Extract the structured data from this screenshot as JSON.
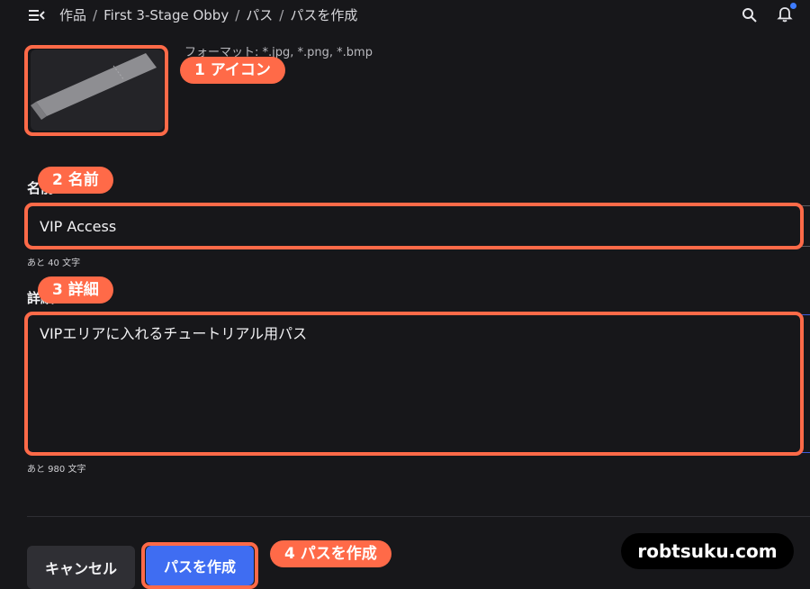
{
  "breadcrumb": {
    "items": [
      "作品",
      "First 3-Stage Obby",
      "パス",
      "パスを作成"
    ],
    "separator": "/"
  },
  "icon_section": {
    "format_note": "フォーマット: *.jpg, *.png, *.bmp"
  },
  "name_field": {
    "label": "名前",
    "value": "VIP Access",
    "counter": "あと 40 文字"
  },
  "description_field": {
    "label": "詳細",
    "value": "VIPエリアに入れるチュートリアル用パス",
    "counter": "あと 980 文字"
  },
  "buttons": {
    "cancel": "キャンセル",
    "create": "パスを作成"
  },
  "annotations": {
    "icon": "1 アイコン",
    "name": "2 名前",
    "description": "3 詳細",
    "create": "4 パスを作成"
  },
  "watermark": "robtsuku.com",
  "icons": [
    "menu-collapse-icon",
    "search-icon",
    "bell-icon",
    "ticket-icon"
  ],
  "colors": {
    "background": "#17171a",
    "accent_blue": "#3f6df2",
    "highlight": "#ff6a48",
    "notification_dot": "#3d7bff"
  }
}
